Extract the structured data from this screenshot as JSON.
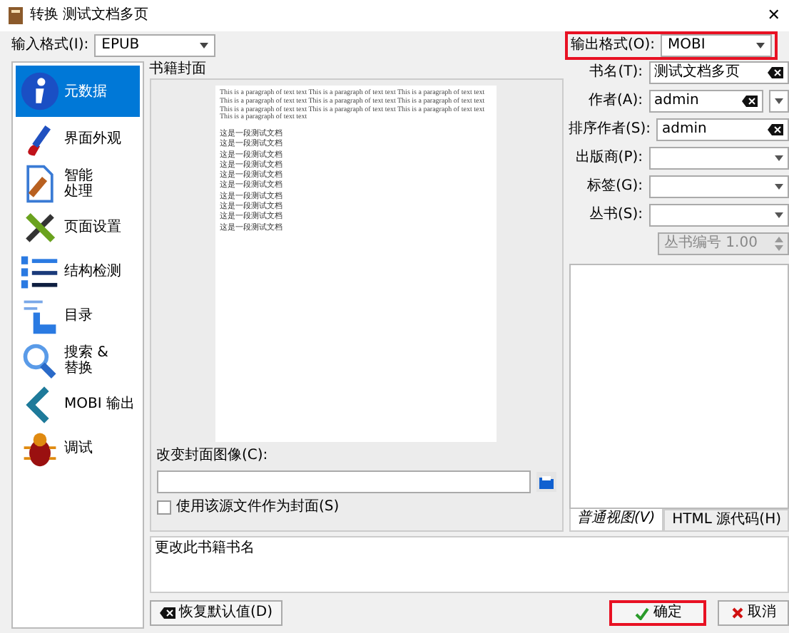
{
  "window": {
    "title": "转换 测试文档多页",
    "close": "✕"
  },
  "input_format": {
    "label": "输入格式(I):",
    "value": "EPUB"
  },
  "output_format": {
    "label": "输出格式(O):",
    "value": "MOBI",
    "highlighted": true
  },
  "sidebar": {
    "items": [
      {
        "lines": [
          "元数据"
        ],
        "selected": true
      },
      {
        "lines": [
          "界面外观"
        ],
        "selected": false
      },
      {
        "lines": [
          "智能",
          "处理"
        ],
        "selected": false
      },
      {
        "lines": [
          "页面设置"
        ],
        "selected": false
      },
      {
        "lines": [
          "结构检测"
        ],
        "selected": false
      },
      {
        "lines": [
          "目录"
        ],
        "selected": false
      },
      {
        "lines": [
          "搜索 &",
          "替换"
        ],
        "selected": false
      },
      {
        "lines": [
          "MOBI 输出"
        ],
        "selected": false
      },
      {
        "lines": [
          "调试"
        ],
        "selected": false
      }
    ]
  },
  "cover": {
    "title": "书籍封面",
    "paragraph": "This is a paragraph of text text This is a paragraph of text text This is a paragraph of text text This is a paragraph of text text This is a paragraph of text text This is a paragraph of text text This is a paragraph of text text This is a paragraph of text text This is a paragraph of text text This is a paragraph of text text",
    "lines": [
      "这是一段测试文档",
      "这是一段测试文档",
      "这是一段测试文档",
      "这是一段测试文档",
      "这是一段测试文档",
      "这是一段测试文档",
      "这是一段测试文档",
      "这是一段测试文档",
      "这是一段测试文档",
      "这是一段测试文档"
    ],
    "change_label": "改变封面图像(C):",
    "use_source_label": "使用该源文件作为封面(S)",
    "use_source_checked": false
  },
  "fields": [
    {
      "label": "书名(T):",
      "value": "测试文档多页",
      "kind": "clear"
    },
    {
      "label": "作者(A):",
      "value": "admin",
      "kind": "clear-combo"
    },
    {
      "label": "排序作者(S):",
      "value": "admin",
      "kind": "clear"
    },
    {
      "label": "出版商(P):",
      "kind": "combo"
    },
    {
      "label": "标签(G):",
      "kind": "combo"
    },
    {
      "label": "丛书(S):",
      "kind": "combo"
    }
  ],
  "series_index": {
    "value": "丛书编号 1.00",
    "disabled": true
  },
  "comments_tabs": [
    {
      "label": "普通视图(V)",
      "selected": true
    },
    {
      "label": "HTML 源代码(H)",
      "selected": false
    }
  ],
  "help_text": "更改此书籍书名",
  "buttons": [
    {
      "label": "恢复默认值(D)",
      "kind": "restore",
      "highlighted": false
    },
    {
      "label": "确定",
      "kind": "ok",
      "highlighted": true
    },
    {
      "label": "取消",
      "kind": "cancel",
      "highlighted": false
    }
  ]
}
